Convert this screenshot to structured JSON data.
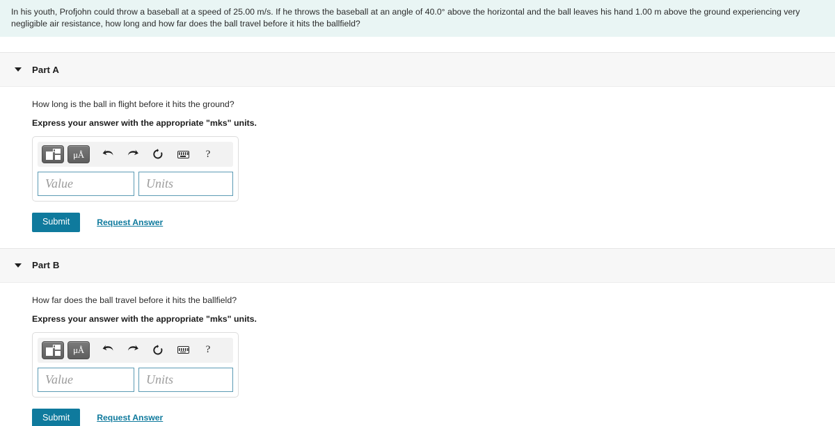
{
  "problem": {
    "text": "In his youth, Profjohn could throw a baseball at a speed of 25.00 m/s. If he throws the baseball at an angle of 40.0° above the horizontal and the ball leaves his hand 1.00 m above the ground experiencing very negligible air resistance, how long and how far does the ball travel before it hits the ballfield?"
  },
  "colors": {
    "banner_bg": "#e9f5f4",
    "part_header_bg": "#f7f7f7",
    "accent_teal": "#0f7a9d",
    "input_border": "#5b9ab4",
    "toolbar_bg": "#f2f2f2",
    "toolbar_button": "#6b6b6b"
  },
  "toolbar": {
    "template_button_label": "",
    "units_button_label": "μÅ",
    "undo_label": "↶",
    "redo_label": "↷",
    "reset_label": "↻",
    "keyboard_label": "",
    "help_label": "?",
    "icons": [
      "math-template-icon",
      "micro-angstrom-units-icon",
      "undo-icon",
      "redo-icon",
      "reset-icon",
      "keyboard-icon",
      "help-icon"
    ]
  },
  "parts": [
    {
      "id": "part-a",
      "title": "Part A",
      "caret_icon": "chevron-down-icon",
      "question": "How long is the ball in flight before it hits the ground?",
      "instruction": "Express your answer with the appropriate \"mks\" units.",
      "value_input": {
        "value": "",
        "placeholder": "Value"
      },
      "units_input": {
        "value": "",
        "placeholder": "Units"
      },
      "submit_label": "Submit",
      "request_answer_label": "Request Answer"
    },
    {
      "id": "part-b",
      "title": "Part B",
      "caret_icon": "chevron-down-icon",
      "question": "How far does the ball travel before it hits the ballfield?",
      "instruction": "Express your answer with the appropriate \"mks\" units.",
      "value_input": {
        "value": "",
        "placeholder": "Value"
      },
      "units_input": {
        "value": "",
        "placeholder": "Units"
      },
      "submit_label": "Submit",
      "request_answer_label": "Request Answer"
    }
  ]
}
